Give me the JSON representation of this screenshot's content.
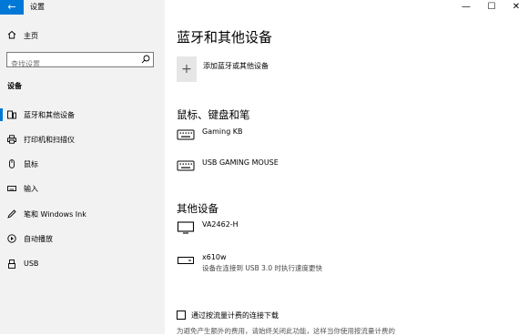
{
  "window": {
    "title": "设置",
    "back_icon": "back-arrow-icon",
    "controls": [
      "—",
      "☐",
      "✕"
    ]
  },
  "nav": {
    "home_label": "主页",
    "search_placeholder": "查找设置",
    "section_label": "设备",
    "items": [
      {
        "label": "蓝牙和其他设备",
        "icon": "bluetooth-devices-icon",
        "active": true
      },
      {
        "label": "打印机和扫描仪",
        "icon": "printer-icon",
        "active": false
      },
      {
        "label": "鼠标",
        "icon": "mouse-icon",
        "active": false
      },
      {
        "label": "输入",
        "icon": "keyboard-icon",
        "active": false
      },
      {
        "label": "笔和 Windows Ink",
        "icon": "pen-icon",
        "active": false
      },
      {
        "label": "自动播放",
        "icon": "autoplay-icon",
        "active": false
      },
      {
        "label": "USB",
        "icon": "usb-icon",
        "active": false
      }
    ]
  },
  "main": {
    "title": "蓝牙和其他设备",
    "add_device_label": "添加蓝牙或其他设备",
    "groups": [
      {
        "header": "鼠标、键盘和笔",
        "devices": [
          {
            "name": "Gaming KB",
            "status": "",
            "icon": "keyboard-device-icon"
          },
          {
            "name": "USB GAMING MOUSE",
            "status": "",
            "icon": "keyboard-device-icon"
          }
        ]
      },
      {
        "header": "其他设备",
        "devices": [
          {
            "name": "VA2462-H",
            "status": "",
            "icon": "monitor-icon"
          },
          {
            "name": "x610w",
            "status": "设备在连接到 USB 3.0 时执行速度更快",
            "icon": "drive-icon"
          }
        ]
      }
    ],
    "metered_checkbox_label": "通过按流量计费的连接下载",
    "metered_checked": false,
    "metered_note": "为避免产生额外的费用，请始终关闭此功能，这样当你使用按流量计费的"
  },
  "colors": {
    "accent": "#0078d7",
    "sidebar_bg": "#f2f2f2"
  }
}
